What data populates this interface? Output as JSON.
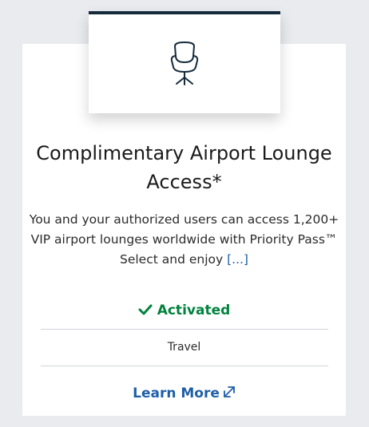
{
  "benefit": {
    "icon": "lounge-chair-icon",
    "title": "Complimentary Airport Lounge Access*",
    "description": "You and your authorized users can access 1,200+ VIP airport lounges worldwide with Priority Pass™ Select and enjoy",
    "more_link": "[...]",
    "status": "Activated",
    "status_icon": "checkmark-icon",
    "category": "Travel",
    "learn_more": "Learn More",
    "learn_more_icon": "external-link-icon"
  },
  "colors": {
    "page_bg": "#e9ebee",
    "tile_border": "#152b3c",
    "status_green": "#00833e",
    "link_blue": "#1f5ea8"
  }
}
